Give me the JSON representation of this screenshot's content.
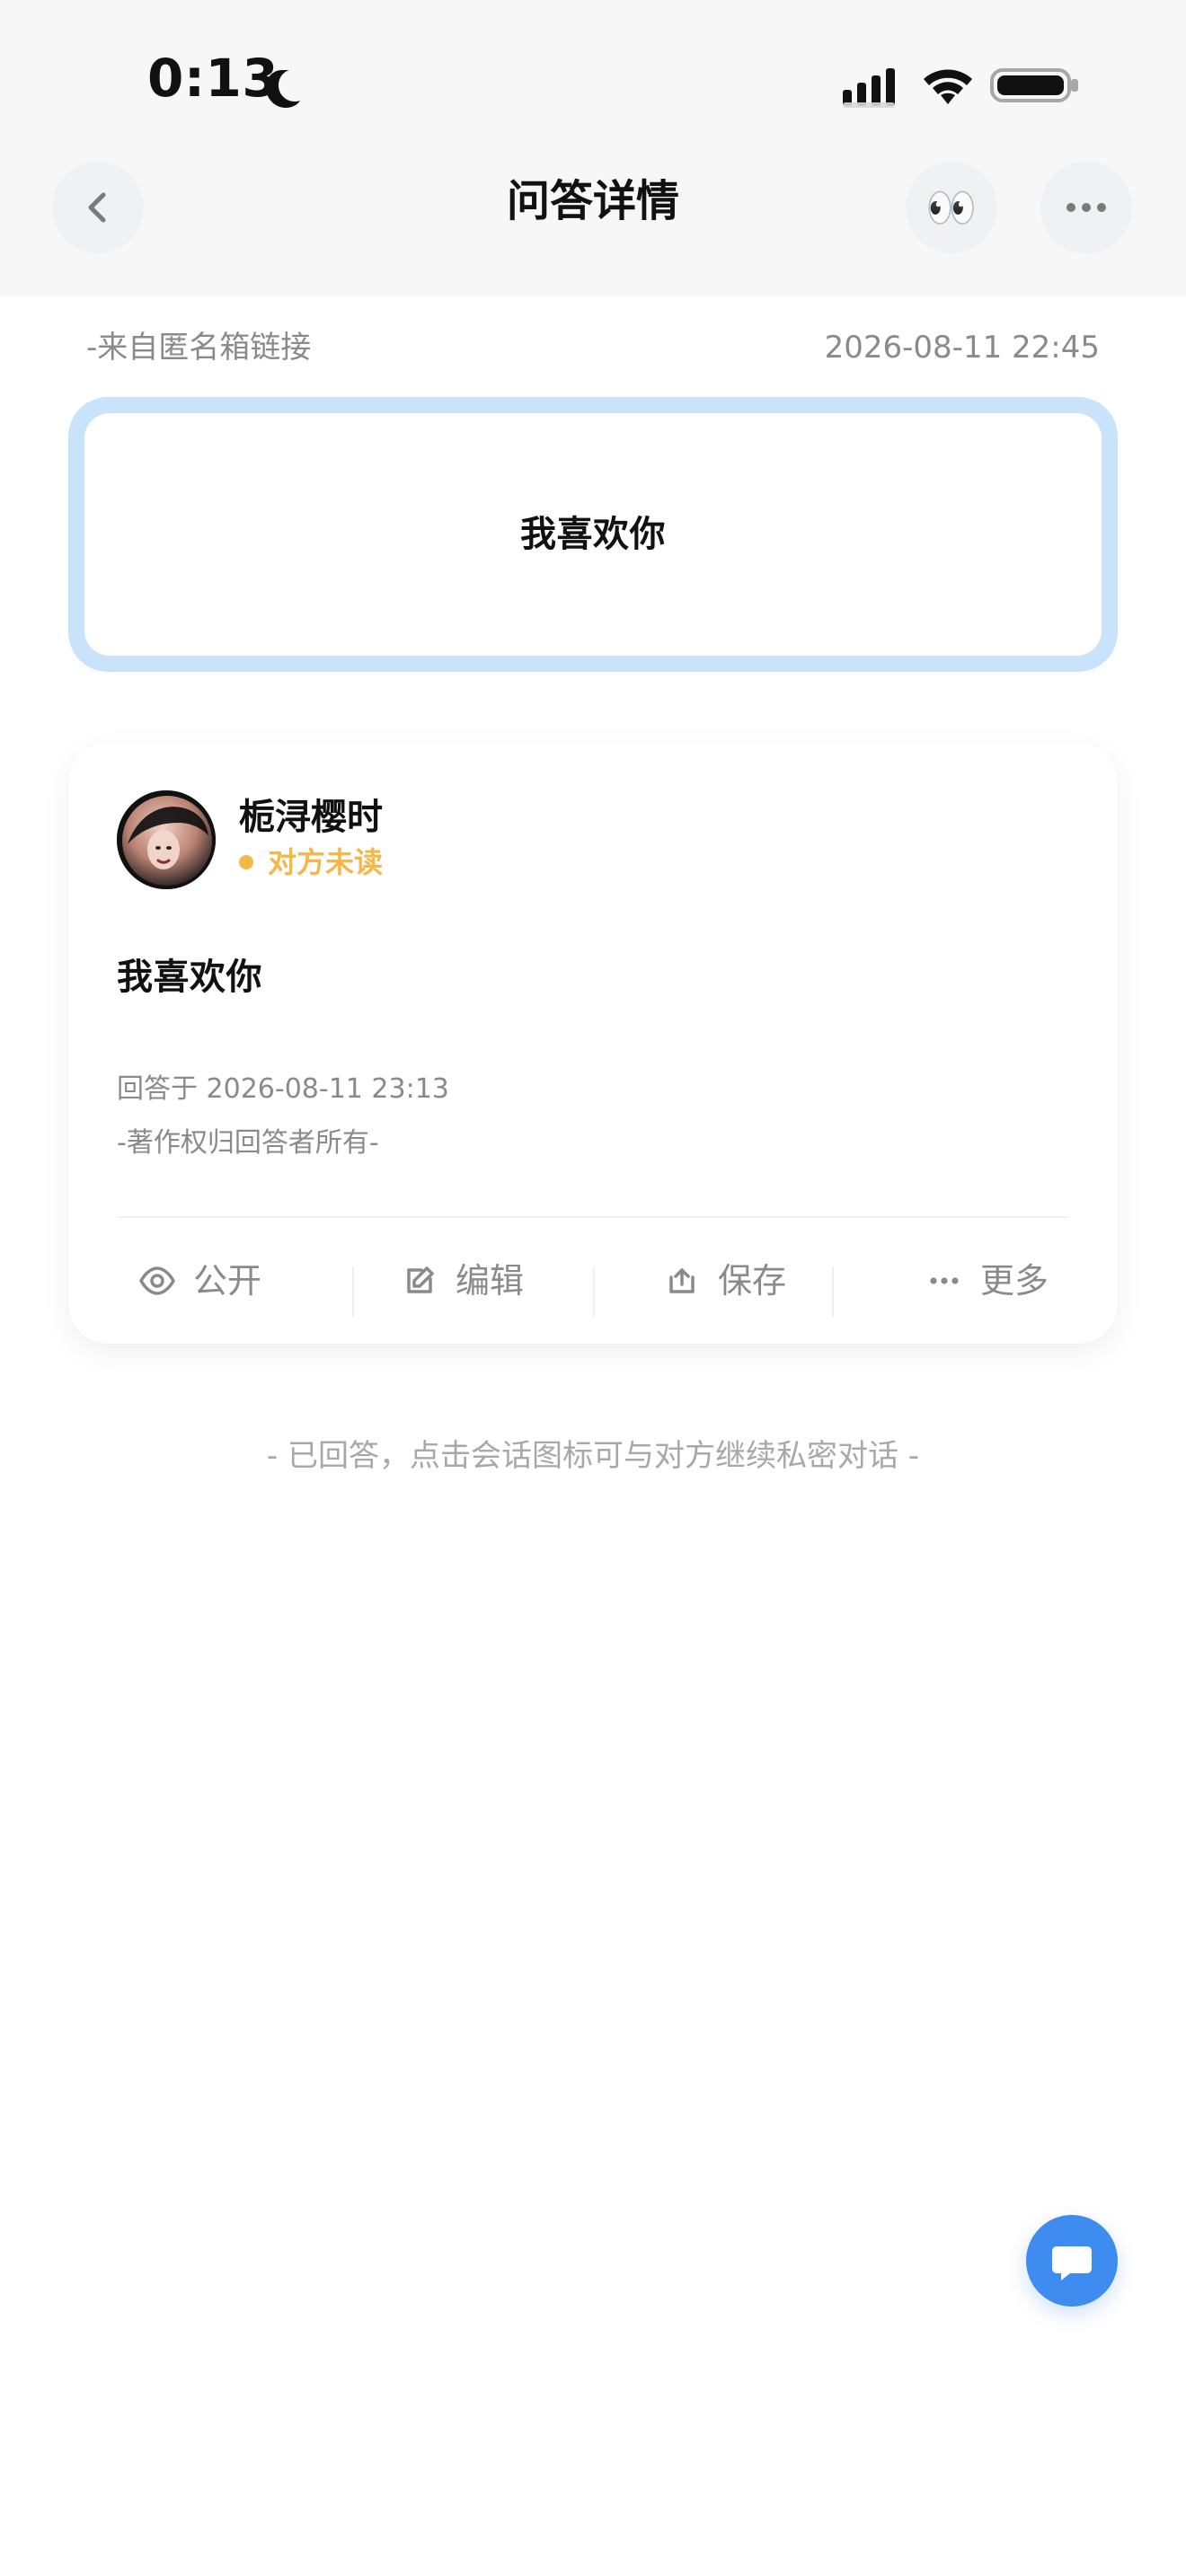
{
  "status_bar": {
    "time": "0:13",
    "icons": {
      "focus": "moon-icon",
      "signal": "cellular-signal-icon",
      "wifi": "wifi-icon",
      "battery": "battery-icon"
    }
  },
  "nav": {
    "title": "问答详情",
    "back_icon": "chevron-left-icon",
    "eyes_emoji": "👀",
    "more_icon": "more-dots-icon"
  },
  "question": {
    "from": "-来自匿名箱链接",
    "timestamp": "2026-08-11 22:45",
    "text": "我喜欢你"
  },
  "answer": {
    "name": "栀浔樱时",
    "read_status": "对方未读",
    "text": "我喜欢你",
    "answered_at": "回答于 2026-08-11 23:13",
    "copyright": "-著作权归回答者所有-",
    "actions": [
      {
        "label": "公开",
        "icon": "eye-icon"
      },
      {
        "label": "编辑",
        "icon": "edit-icon"
      },
      {
        "label": "保存",
        "icon": "save-icon"
      },
      {
        "label": "更多",
        "icon": "more-dots-icon"
      }
    ]
  },
  "hint": "- 已回答，点击会话图标可与对方继续私密对话 -",
  "colors": {
    "accent_blue": "#3f8cf0",
    "question_border": "#c9e3fb",
    "unread_orange": "#f5b74a",
    "muted_gray": "#8a8a8a",
    "hint_gray": "#a8a8a8"
  },
  "fab": {
    "icon": "chat-bubble-icon"
  }
}
